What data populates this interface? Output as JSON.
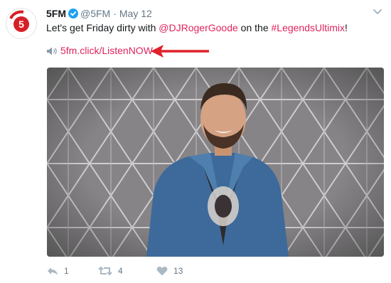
{
  "tweet": {
    "author_name": "5FM",
    "handle": "@5FM",
    "separator": "·",
    "date": "May 12",
    "text_before": "Let's get Friday dirty with ",
    "mention": "@DJRogerGoode",
    "text_middle": " on the ",
    "hashtag": "#LegendsUltimix",
    "text_after": "!",
    "link": "5fm.click/ListenNOW"
  },
  "actions": {
    "reply_count": "1",
    "retweet_count": "4",
    "like_count": "13"
  },
  "colors": {
    "link": "#e0245e",
    "verified": "#1da1f2",
    "muted": "#657786",
    "annotation_arrow": "#e0202a",
    "brand_red": "#d71f26"
  },
  "icons": [
    "verified-badge-icon",
    "chevron-down-icon",
    "speaker-icon",
    "reply-icon",
    "retweet-icon",
    "heart-icon",
    "arrow-annotation"
  ]
}
